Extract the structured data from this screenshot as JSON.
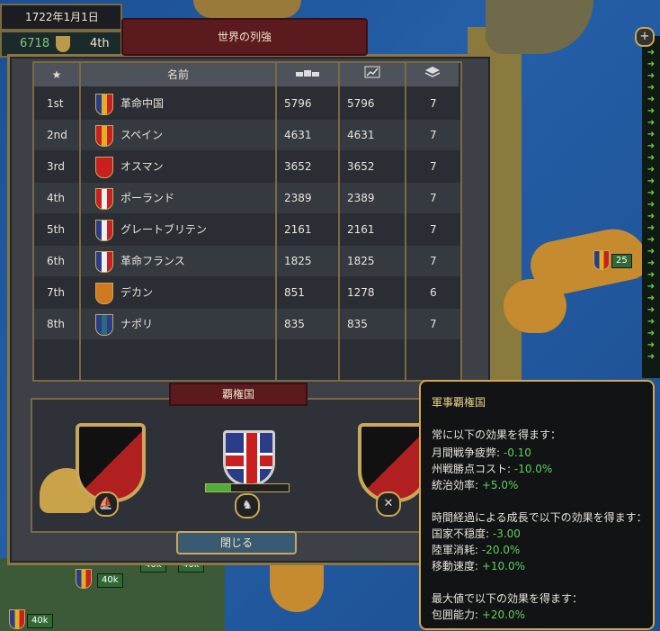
{
  "date": "1722年1月1日",
  "player": {
    "score": "6718",
    "rank": "4th"
  },
  "window_title": "世界の列強",
  "table": {
    "headers": {
      "star": "★",
      "name": "名前",
      "icon_cols": [
        "army-icon",
        "trend-icon",
        "stack-icon"
      ]
    },
    "rows": [
      {
        "rank": "1st",
        "name": "革命中国",
        "a": "5796",
        "b": "5796",
        "c": "7",
        "flag_colors": [
          "#2a3c8a",
          "#e0b020",
          "#c82020"
        ]
      },
      {
        "rank": "2nd",
        "name": "スペイン",
        "a": "4631",
        "b": "4631",
        "c": "7",
        "flag_colors": [
          "#c82020",
          "#e0b020",
          "#c82020"
        ]
      },
      {
        "rank": "3rd",
        "name": "オスマン",
        "a": "3652",
        "b": "3652",
        "c": "7",
        "flag_colors": [
          "#c82020",
          "#c82020",
          "#c82020"
        ]
      },
      {
        "rank": "4th",
        "name": "ポーランド",
        "a": "2389",
        "b": "2389",
        "c": "7",
        "flag_colors": [
          "#c82020",
          "#f0f0f0",
          "#c82020"
        ]
      },
      {
        "rank": "5th",
        "name": "グレートブリテン",
        "a": "2161",
        "b": "2161",
        "c": "7",
        "flag_colors": [
          "#2a3c8a",
          "#f0f0f0",
          "#c82020"
        ]
      },
      {
        "rank": "6th",
        "name": "革命フランス",
        "a": "1825",
        "b": "1825",
        "c": "7",
        "flag_colors": [
          "#2a3c8a",
          "#f0f0f0",
          "#c82020"
        ]
      },
      {
        "rank": "7th",
        "name": "デカン",
        "a": "851",
        "b": "1278",
        "c": "6",
        "flag_colors": [
          "#d07a20",
          "#d07a20",
          "#d07a20"
        ]
      },
      {
        "rank": "8th",
        "name": "ナポリ",
        "a": "835",
        "b": "835",
        "c": "7",
        "flag_colors": [
          "#2a3c8a",
          "#2a6a7a",
          "#2a3c8a"
        ]
      }
    ]
  },
  "hegemony": {
    "title": "覇権国",
    "progress": 0.3
  },
  "close_label": "閉じる",
  "tooltip": {
    "title": "軍事覇権国",
    "always_heading": "常に以下の効果を得ます：",
    "always": [
      {
        "label": "月間戦争疲弊: ",
        "value": "-0.10"
      },
      {
        "label": "州戦勝点コスト: ",
        "value": "-10.0%"
      },
      {
        "label": "統治効率: ",
        "value": "+5.0%"
      }
    ],
    "growth_heading": "時間経過による成長で以下の効果を得ます：",
    "growth": [
      {
        "label": "国家不穏度: ",
        "value": "-3.00"
      },
      {
        "label": "陸軍消耗: ",
        "value": "-20.0%"
      },
      {
        "label": "移動速度: ",
        "value": "+10.0%"
      }
    ],
    "max_heading": "最大値で以下の効果を得ます：",
    "max": [
      {
        "label": "包囲能力: ",
        "value": "+20.0%"
      }
    ]
  },
  "map": {
    "armies": [
      {
        "label": "40k"
      },
      {
        "label": "40k"
      },
      {
        "label": "40k"
      },
      {
        "label": "40k"
      },
      {
        "label": "25"
      }
    ],
    "plus_label": "+"
  }
}
